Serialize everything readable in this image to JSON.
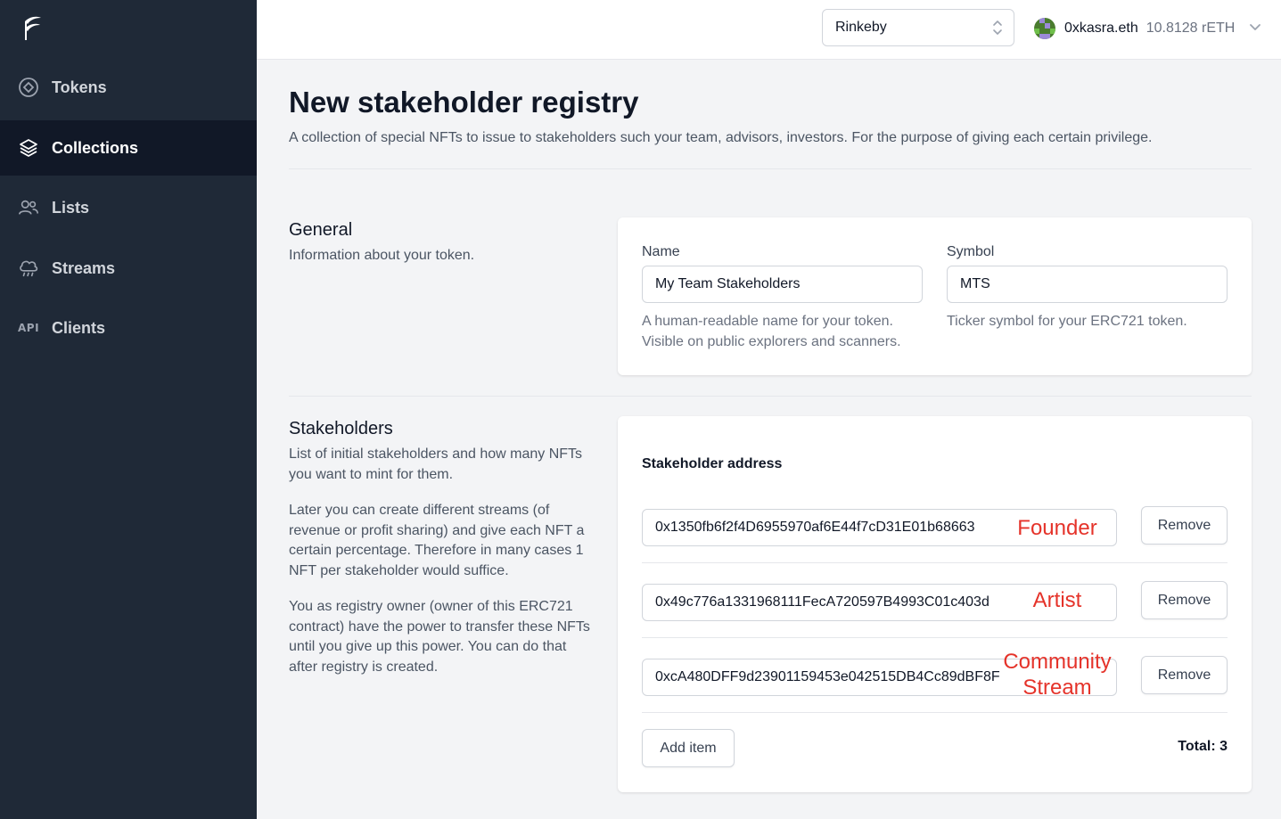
{
  "sidebar": {
    "items": [
      {
        "label": "Tokens",
        "icon": "token-icon"
      },
      {
        "label": "Collections",
        "icon": "stack-icon"
      },
      {
        "label": "Lists",
        "icon": "users-icon"
      },
      {
        "label": "Streams",
        "icon": "cloud-rain-icon"
      },
      {
        "label": "Clients",
        "icon": "api-icon",
        "icon_text": "API"
      }
    ],
    "active": "Collections"
  },
  "topbar": {
    "network": "Rinkeby",
    "account_name": "0xkasra.eth",
    "balance": "10.8128 rETH"
  },
  "page": {
    "title": "New stakeholder registry",
    "description": "A collection of special NFTs to issue to stakeholders such your team, advisors, investors. For the purpose of giving each certain privilege."
  },
  "general": {
    "title": "General",
    "description": "Information about your token.",
    "name_label": "Name",
    "name_value": "My Team Stakeholders",
    "name_help_1": "A human-readable name for your token.",
    "name_help_2": "Visible on public explorers and scanners.",
    "symbol_label": "Symbol",
    "symbol_value": "MTS",
    "symbol_help": "Ticker symbol for your ERC721 token."
  },
  "stakeholders": {
    "title": "Stakeholders",
    "para1": "List of initial stakeholders and how many NFTs you want to mint for them.",
    "para2": "Later you can create different streams (of revenue or profit sharing) and give each NFT a certain percentage. Therefore in many cases 1 NFT per stakeholder would suffice.",
    "para3": "You as registry owner (owner of this ERC721 contract) have the power to transfer these NFTs until you give up this power. You can do that after registry is created.",
    "address_label": "Stakeholder address",
    "rows": [
      {
        "address": "0x1350fb6f2f4D6955970af6E44f7cD31E01b68663",
        "annotation": "Founder",
        "remove_label": "Remove"
      },
      {
        "address": "0x49c776a1331968111FecA720597B4993C01c403d",
        "annotation": "Artist",
        "remove_label": "Remove"
      },
      {
        "address": "0xcA480DFF9d23901159453e042515DB4Cc89dBF8F",
        "annotation_line1": "Community",
        "annotation_line2": "Stream",
        "remove_label": "Remove"
      }
    ],
    "add_label": "Add item",
    "total": "Total: 3"
  },
  "colors": {
    "sidebar_bg": "#1f2937",
    "sidebar_active": "#111827",
    "annotation_red": "#e5332a"
  }
}
